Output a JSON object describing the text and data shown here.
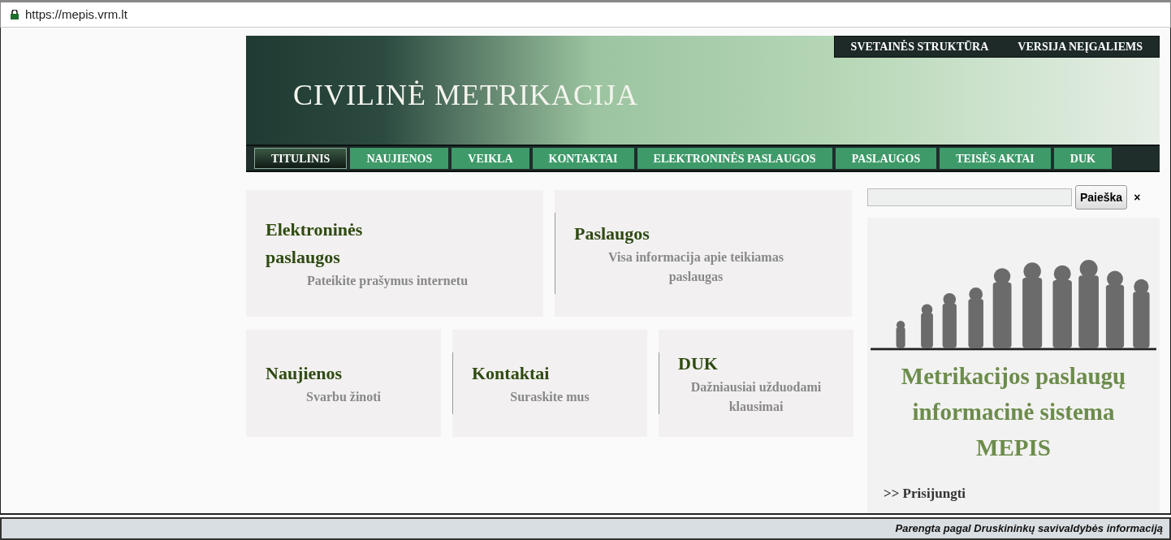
{
  "address_bar": {
    "url": "https://mepis.vrm.lt"
  },
  "header": {
    "title": "CIVILINĖ METRIKACIJA",
    "top_links": [
      "SVETAINĖS STRUKTŪRA",
      "VERSIJA NEĮGALIEMS"
    ]
  },
  "nav": [
    {
      "label": "TITULINIS",
      "selected": true
    },
    {
      "label": "NAUJIENOS",
      "selected": false
    },
    {
      "label": "VEIKLA",
      "selected": false
    },
    {
      "label": "KONTAKTAI",
      "selected": false
    },
    {
      "label": "ELEKTRONINĖS PASLAUGOS",
      "selected": false
    },
    {
      "label": "PASLAUGOS",
      "selected": false
    },
    {
      "label": "TEISĖS AKTAI",
      "selected": false
    },
    {
      "label": "DUK",
      "selected": false
    }
  ],
  "tiles_top": [
    {
      "title": "Elektroninės paslaugos",
      "subtitle": "Pateikite prašymus internetu"
    },
    {
      "title": "Paslaugos",
      "subtitle": "Visa informacija apie teikiamas paslaugas"
    }
  ],
  "tiles_bottom": [
    {
      "title": "Naujienos",
      "subtitle": "Svarbu žinoti"
    },
    {
      "title": "Kontaktai",
      "subtitle": "Suraskite mus"
    },
    {
      "title": "DUK",
      "subtitle": "Dažniausiai užduodami klausimai"
    }
  ],
  "search": {
    "button": "Paieška",
    "clear": "×"
  },
  "promo": {
    "title": "Metrikacijos paslaugų informacinė sistema MEPIS",
    "link": ">> Prisijungti"
  },
  "footer": {
    "caption": "Parengta pagal Druskininkų savivaldybės informaciją"
  }
}
